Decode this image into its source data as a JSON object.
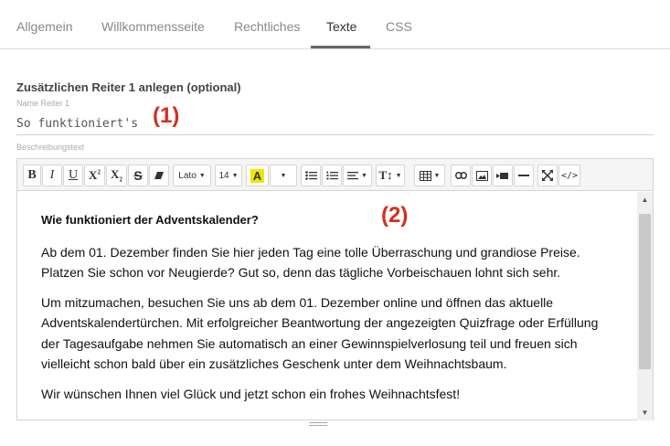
{
  "tabs": [
    {
      "label": "Allgemein",
      "active": false
    },
    {
      "label": "Willkommensseite",
      "active": false
    },
    {
      "label": "Rechtliches",
      "active": false
    },
    {
      "label": "Texte",
      "active": true
    },
    {
      "label": "CSS",
      "active": false
    }
  ],
  "section": {
    "title": "Zusätzlichen Reiter 1 anlegen (optional)",
    "name_label": "Name Reiter 1",
    "name_value": "So funktioniert's",
    "description_label": "Beschreibungstext"
  },
  "annotations": {
    "first": "(1)",
    "second": "(2)"
  },
  "toolbar": {
    "font_family": "Lato",
    "font_size": "14",
    "highlight_letter": "A",
    "highlight_color": "#f2e600",
    "buttons": [
      "bold-icon",
      "italic-icon",
      "underline-icon",
      "superscript-icon",
      "subscript-icon",
      "strikethrough-icon",
      "eraser-icon",
      "font-family-dropdown",
      "font-size-dropdown",
      "text-color-icon",
      "color-dropdown",
      "unordered-list-icon",
      "ordered-list-icon",
      "align-dropdown",
      "line-height-icon",
      "table-icon",
      "link-icon",
      "image-icon",
      "video-icon",
      "horizontal-rule-icon",
      "fullscreen-icon",
      "code-view-icon"
    ]
  },
  "content": {
    "heading": "Wie funktioniert der Adventskalender?",
    "paragraph1": "Ab dem 01. Dezember finden Sie hier jeden Tag eine tolle Überraschung und grandiose Preise. Platzen Sie schon vor Neugierde? Gut so, denn das tägliche Vorbeischauen lohnt sich sehr.",
    "paragraph2": "Um mitzumachen, besuchen Sie uns ab dem 01. Dezember online und öffnen das aktuelle Adventskalendertürchen. Mit erfolgreicher Beantwortung der angezeigten Quizfrage oder Erfüllung der Tagesaufgabe nehmen Sie automatisch an einer Gewinnspielverlosung teil und freuen sich vielleicht schon bald über ein zusätzliches Geschenk unter dem Weihnachtsbaum.",
    "paragraph3": "Wir wünschen Ihnen viel Glück und jetzt schon ein frohes Weihnachtsfest!"
  }
}
